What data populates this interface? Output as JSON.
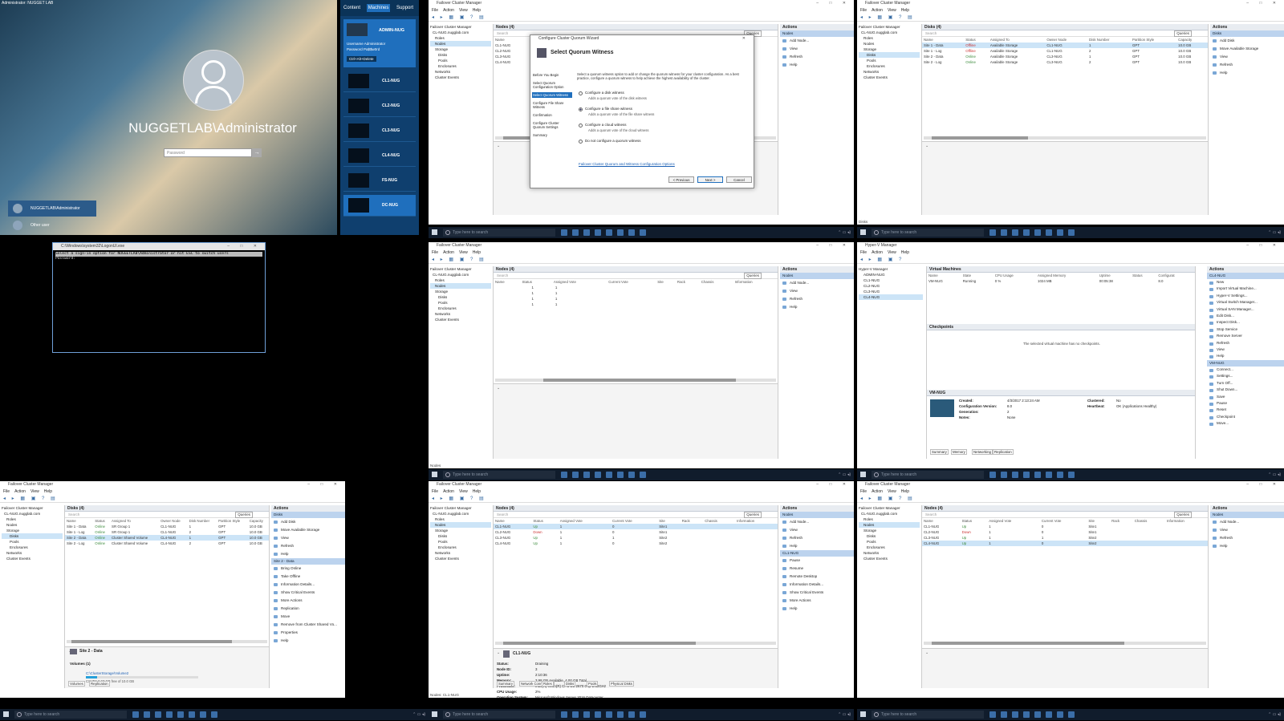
{
  "login": {
    "top_text": "Administrator: NUGGET LAB",
    "username": "NUGGETLAB\\Administrator",
    "password_placeholder": "Password",
    "user_tile": "NUGGETLAB\\Administrator",
    "other_user": "Other user"
  },
  "rdm": {
    "tabs": [
      "Content",
      "Machines",
      "Support"
    ],
    "time": "1:38:50 Min Remaining",
    "current": {
      "name": "ADMIN-NUG",
      "l1": "Username",
      "v1": "Administrator",
      "l2": "Password",
      "v2": "Pa$$w0rd",
      "btn": "Ctrl+Alt+Delete"
    },
    "machines": [
      "CL1-NUG",
      "CL2-NUG",
      "CL3-NUG",
      "CL4-NUG",
      "FS-NUG",
      "DC-NUG"
    ]
  },
  "cmd": {
    "title": "C:\\Windows\\system32\\LogonUI.exe",
    "line1": "Select a sign-in option for NUGGETLAB\\Administrator or hit ESC to switch users",
    "line2": "Password:"
  },
  "fcm": {
    "title": "Failover Cluster Manager",
    "menu": [
      "File",
      "Action",
      "View",
      "Help"
    ],
    "tree": [
      "Failover Cluster Manager",
      "CL-NUG.nugglab.com",
      "Roles",
      "Nodes",
      "Storage",
      "Disks",
      "Pools",
      "Enclosures",
      "Networks",
      "Cluster Events"
    ],
    "search": "Search",
    "actions_title": "Actions",
    "queries": "Queries",
    "nodes_title": "Nodes (4)",
    "disks_title": "Disks (4)",
    "node_cols": [
      "Name",
      "Status",
      "Assigned Vote",
      "Current Vote",
      "Site",
      "Rack",
      "Chassis",
      "Information"
    ],
    "node_rows": [
      [
        "CL1-NUG",
        "Up",
        "1",
        "1",
        "Site1",
        "",
        "",
        ""
      ],
      [
        "CL2-NUG",
        "Up",
        "1",
        "1",
        "Site1",
        "",
        "",
        ""
      ],
      [
        "CL3-NUG",
        "Up",
        "1",
        "1",
        "Site2",
        "",
        "",
        ""
      ],
      [
        "CL4-NUG",
        "Up",
        "1",
        "1",
        "Site2",
        "",
        "",
        ""
      ]
    ],
    "node_rows_b": [
      [
        "CL1-NUG",
        "Up",
        "1",
        "0",
        "Site1",
        "",
        "",
        ""
      ],
      [
        "CL2-NUG",
        "Down",
        "1",
        "0",
        "Site1",
        "",
        "",
        ""
      ],
      [
        "CL3-NUG",
        "Up",
        "1",
        "1",
        "Site2",
        "",
        "",
        ""
      ],
      [
        "CL4-NUG",
        "Up",
        "1",
        "0",
        "Site2",
        "",
        "",
        ""
      ]
    ],
    "node_rows_c": [
      [
        "CL1-NUG",
        "Up",
        "1",
        "0",
        "Site1",
        "",
        "",
        ""
      ],
      [
        "CL2-NUG",
        "Down",
        "1",
        "0",
        "Site1",
        "",
        "",
        ""
      ],
      [
        "CL3-NUG",
        "Up",
        "1",
        "1",
        "Site2",
        "",
        "",
        ""
      ],
      [
        "CL4-NUG",
        "Up",
        "1",
        "0",
        "Site2",
        "",
        "",
        ""
      ]
    ],
    "vote_rows": [
      [
        "",
        "1",
        "1"
      ],
      [
        "",
        "1",
        "1"
      ],
      [
        "",
        "1",
        "1"
      ],
      [
        "",
        "1",
        "1"
      ]
    ],
    "disk_cols": [
      "Name",
      "Status",
      "Assigned To",
      "Owner Node",
      "Disk Number",
      "Partition Style",
      "Capacity"
    ],
    "disk_rows": [
      [
        "Site 1 - Data",
        "Offline",
        "Available Storage",
        "CL1-NUG",
        "1",
        "GPT",
        "10.0 GB"
      ],
      [
        "Site 1 - Log",
        "Offline",
        "Available Storage",
        "CL1-NUG",
        "2",
        "GPT",
        "10.0 GB"
      ],
      [
        "Site 2 - Data",
        "Online",
        "Available Storage",
        "CL3-NUG",
        "1",
        "GPT",
        "10.0 GB"
      ],
      [
        "Site 2 - Log",
        "Online",
        "Available Storage",
        "CL3-NUG",
        "2",
        "GPT",
        "10.0 GB"
      ]
    ],
    "disk_rows_b": [
      [
        "Site 1 - Data",
        "Online",
        "SR Group 1",
        "CL1-NUG",
        "1",
        "GPT",
        "10.0 GB"
      ],
      [
        "Site 1 - Log",
        "Online",
        "SR Group 1",
        "CL1-NUG",
        "2",
        "GPT",
        "10.0 GB"
      ],
      [
        "Site 2 - Data",
        "Online",
        "Cluster Shared Volume",
        "CL4-NUG",
        "1",
        "GPT",
        "10.0 GB"
      ],
      [
        "Site 2 - Log",
        "Online",
        "Cluster Shared Volume",
        "CL4-NUG",
        "2",
        "GPT",
        "10.0 GB"
      ]
    ],
    "node_actions": [
      "Nodes",
      "Add Node...",
      "View",
      "Refresh",
      "Help"
    ],
    "disk_actions": [
      "Disks",
      "Add Disk",
      "Move Available Storage",
      "View",
      "Refresh",
      "Help"
    ],
    "disk_sel_title": "Site 2 - Data",
    "disk_sel_actions": [
      "Bring Online",
      "Take Offline",
      "Information Details...",
      "Show Critical Events",
      "More Actions",
      "Replication",
      "Move",
      "Remove from Cluster Shared Vo...",
      "Properties",
      "Help"
    ],
    "node_sel_title": "CL1-NUG",
    "node_sel_actions": [
      "Pause",
      "Resume",
      "Remote Desktop",
      "Information Details...",
      "Show Critical Events",
      "More Actions",
      "Help"
    ],
    "disk_detail_title": "Site 2 - Data",
    "volumes_label": "Volumes (1)",
    "volume_path": "C:\\ClusterStorage\\Volume2",
    "volume_info": "CSVFS 9.97 GB free of 10.0 GB",
    "disk_tabs": [
      "Volumes",
      "Replication"
    ],
    "node_detail_title": "CL1-NUG",
    "node_detail": [
      [
        "Status:",
        "Draining"
      ],
      [
        "Node ID:",
        "3"
      ],
      [
        "Uptime:",
        "2:10:36"
      ],
      [
        "Memory:",
        "3.98 GB Available, 4.00 GB Total"
      ],
      [
        "Processor:",
        "Intel(R) Xeon(R) CPU E5-2670 0 @ 2.60GHz"
      ],
      [
        "CPU Usage:",
        "2%"
      ],
      [
        "Operating System:",
        "Microsoft Windows Server 2016 Datacenter"
      ],
      [
        "Version:",
        "10.0.14393"
      ]
    ],
    "node_tabs": [
      "Summary",
      "Network Connections",
      "Roles",
      "Disks",
      "Pools",
      "Physical Disks"
    ],
    "status_nodes": "Nodes: CL1-NUG",
    "status_disks": "Disks",
    "status_nodes2": "Nodes"
  },
  "wizard": {
    "title": "Configure Cluster Quorum Wizard",
    "heading": "Select Quorum Witness",
    "steps": [
      "Before You Begin",
      "Select Quorum Configuration Option",
      "Select Quorum Witness",
      "Configure File Share Witness",
      "Confirmation",
      "Configure Cluster Quorum Settings",
      "Summary"
    ],
    "intro": "Select a quorum witness option to add or change the quorum witness for your cluster configuration. As a best practice, configure a quorum witness to help achieve the highest availability of the cluster.",
    "options": [
      [
        "Configure a disk witness",
        "Adds a quorum vote of the disk witness"
      ],
      [
        "Configure a file share witness",
        "Adds a quorum vote of the file share witness"
      ],
      [
        "Configure a cloud witness",
        "Adds a quorum vote of the cloud witness"
      ],
      [
        "Do not configure a quorum witness",
        ""
      ]
    ],
    "link": "Failover Cluster Quorum and Witness Configuration Options",
    "buttons": [
      "< Previous",
      "Next >",
      "Cancel"
    ]
  },
  "hyperv": {
    "title": "Hyper-V Manager",
    "tree": [
      "Hyper-V Manager",
      "ADMIN-NUG",
      "CL1-NUG",
      "CL2-NUG",
      "CL3-NUG",
      "CL4-NUG"
    ],
    "vm_title": "Virtual Machines",
    "vm_cols": [
      "Name",
      "State",
      "CPU Usage",
      "Assigned Memory",
      "Uptime",
      "Status",
      "Configurat"
    ],
    "vm_row": [
      "VM-NUG",
      "Running",
      "0 %",
      "1024 MB",
      "00:05:38",
      "",
      "8.0"
    ],
    "ck_title": "Checkpoints",
    "ck_msg": "The selected virtual machine has no checkpoints.",
    "detail_title": "VM-NUG",
    "detail": [
      [
        "Created:",
        "4/3/2017 2:13:24 AM"
      ],
      [
        "Configuration Version:",
        "8.0"
      ],
      [
        "Generation:",
        "2"
      ],
      [
        "Notes:",
        "None"
      ]
    ],
    "detail_right": [
      [
        "Clustered:",
        "No"
      ],
      [
        "Heartbeat:",
        "OK (Applications Healthy)"
      ]
    ],
    "detail_tabs": [
      "Summary",
      "Memory",
      "Networking",
      "Replication"
    ],
    "act_title": "Actions",
    "act_host": "CL4-NUG",
    "act_items": [
      "New",
      "Import Virtual Machine...",
      "Hyper-V Settings...",
      "Virtual Switch Manager...",
      "Virtual SAN Manager...",
      "Edit Disk...",
      "Inspect Disk...",
      "Stop Service",
      "Remove Server",
      "Refresh",
      "View",
      "Help"
    ],
    "act_vm": "VM-NUG",
    "act_vm_items": [
      "Connect...",
      "Settings...",
      "Turn Off...",
      "Shut Down...",
      "Save",
      "Pause",
      "Reset",
      "Checkpoint",
      "Move..."
    ]
  },
  "taskbar": {
    "search": "Type here to search"
  }
}
